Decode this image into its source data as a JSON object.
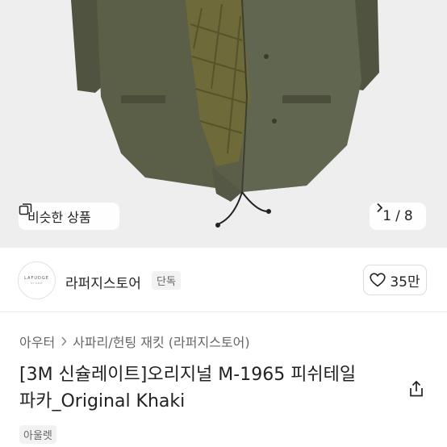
{
  "gallery": {
    "similar_label": "비슷한 상품",
    "current": "1",
    "total": "8",
    "separator": "/",
    "similar_icon": "copy-icon",
    "next_icon": "chevron-right-icon"
  },
  "store": {
    "logo_text": "LAFUDGE",
    "logo_subtext": "STORE",
    "name": "라퍼지스토어",
    "badge": "단독",
    "likes": "35만",
    "like_icon": "heart-icon"
  },
  "breadcrumb": {
    "items": [
      "아우터",
      "사파리/헌팅 재킷 (라퍼지스토어)"
    ],
    "separator_icon": "chevron-right-icon"
  },
  "product": {
    "title_line1": "[3M 신슐레이트]오리지널 M-1965 피쉬테일",
    "title_line2": "파카_Original Khaki",
    "share_icon": "share-icon",
    "tag": "아울렛"
  },
  "colors": {
    "parka": "#5b5f48",
    "lining": "#6e6a3a",
    "background": "#eeeeee"
  }
}
